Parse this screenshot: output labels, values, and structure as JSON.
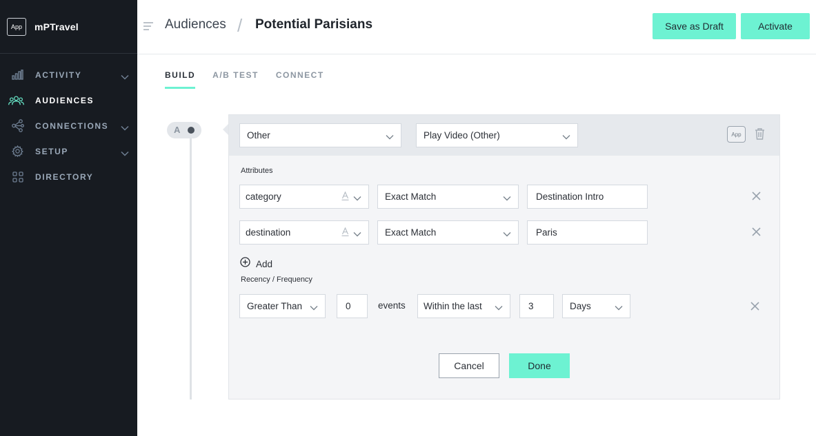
{
  "sidebar": {
    "app_badge": "App",
    "brand": "mPTravel",
    "items": [
      {
        "label": "ACTIVITY",
        "icon": "bar-chart-icon",
        "expandable": true
      },
      {
        "label": "AUDIENCES",
        "icon": "people-icon",
        "expandable": false,
        "active": true
      },
      {
        "label": "CONNECTIONS",
        "icon": "network-icon",
        "expandable": true
      },
      {
        "label": "SETUP",
        "icon": "gear-icon",
        "expandable": true
      },
      {
        "label": "DIRECTORY",
        "icon": "grid-icon",
        "expandable": false
      }
    ]
  },
  "header": {
    "breadcrumb_root": "Audiences",
    "breadcrumb_separator": "/",
    "breadcrumb_current": "Potential Parisians",
    "save_draft_label": "Save as Draft",
    "activate_label": "Activate"
  },
  "tabs": [
    {
      "label": "BUILD",
      "active": true
    },
    {
      "label": "A/B TEST",
      "active": false
    },
    {
      "label": "CONNECT",
      "active": false
    }
  ],
  "timeline": {
    "node_letter": "A"
  },
  "criteria": {
    "event_type": "Other",
    "event_name": "Play Video (Other)",
    "app_badge": "App",
    "attributes_label": "Attributes",
    "attributes": [
      {
        "name": "category",
        "operator": "Exact Match",
        "value": "Destination Intro"
      },
      {
        "name": "destination",
        "operator": "Exact Match",
        "value": "Paris"
      }
    ],
    "add_label": "Add",
    "recency_label": "Recency / Frequency",
    "recency": {
      "comparison": "Greater Than",
      "count": "0",
      "events_label": "events",
      "window": "Within the last",
      "window_value": "3",
      "window_unit": "Days"
    },
    "cancel_label": "Cancel",
    "done_label": "Done"
  },
  "colors": {
    "accent": "#6df2d2",
    "sidebar_bg": "#171b21",
    "panel_bg": "#f4f5f7"
  }
}
